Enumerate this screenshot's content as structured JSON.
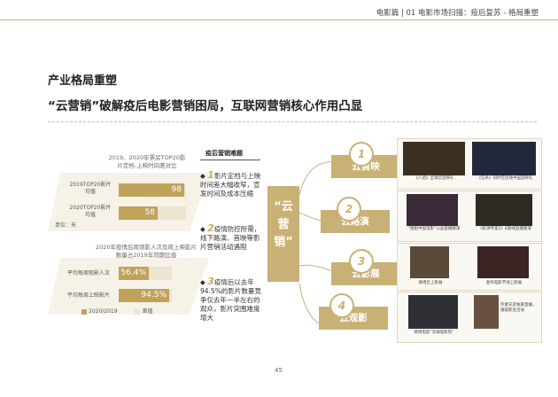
{
  "header": {
    "breadcrumb": "电影篇 | 01 电影市场扫描：疫后复苏 - 格局重塑"
  },
  "title": "产业格局重塑",
  "subtitle": "“云营销”破解疫后电影营销困局，互联网营销核心作用凸显",
  "chart1": {
    "caption_line1": "2019、2020年票房TOP20影",
    "caption_line2": "片定档-上映时间差对比",
    "unit": "单位：天",
    "bars": [
      {
        "label_line1": "2019TOP20影片",
        "label_line2": "均值",
        "value": "98",
        "fraction": 0.98
      },
      {
        "label_line1": "2020TOP20影片",
        "label_line2": "均值",
        "value": "58",
        "fraction": 0.58
      }
    ]
  },
  "chart2": {
    "caption_line1": "2020年疫情后周观影人次及周上映影片",
    "caption_line2": "数量占2019年同期比值",
    "bars": [
      {
        "label": "平均每周观影人次",
        "value": "56.4%",
        "fraction": 0.564
      },
      {
        "label": "平均每周上映影片",
        "value": "94.5%",
        "fraction": 0.945
      }
    ],
    "legend": [
      {
        "label": "2020/2019",
        "color": "#bfa35b"
      },
      {
        "label": "差值",
        "color": "#ece4d0"
      }
    ]
  },
  "difficulties": {
    "heading": "疫后营销难题",
    "items": [
      {
        "num": "1",
        "text": "影片定档与上映时间差大幅收窄，宣发时间及成本压缩"
      },
      {
        "num": "2",
        "text": "疫情防控所需，线下路演、首映等影片营销活动遇阻"
      },
      {
        "num": "3",
        "text": "疫情后以去年94.5%的影片数量竞争仅去年一半左右的观众，影片突围难度增大"
      }
    ]
  },
  "center": {
    "chars": [
      "“云",
      "营",
      "销”"
    ]
  },
  "categories": [
    {
      "num": "1",
      "label": "云首映"
    },
    {
      "num": "2",
      "label": "云路演"
    },
    {
      "num": "3",
      "label": "云影展"
    },
    {
      "num": "4",
      "label": "云观影"
    }
  ],
  "panels": [
    {
      "captions": [
        "《八佰》全球云首映礼",
        "《信条》同时空连线中国首映礼"
      ]
    },
    {
      "captions": [
        "“姐姐中国电影”公益直播路演",
        "《拆弹专家2》K歌线直播路演"
      ]
    },
    {
      "captions": [
        "微博云上影展",
        "金鸡电影节线上影展"
      ]
    },
    {
      "captions": [
        "微博电影“云端电影院”",
        "罗素兄弟独家直播，邀观影连活动"
      ]
    }
  ],
  "page_number": "45",
  "colors": {
    "accent": "#c9b075",
    "bar": "#bfa35b",
    "bar_bg": "#ece4d0"
  }
}
